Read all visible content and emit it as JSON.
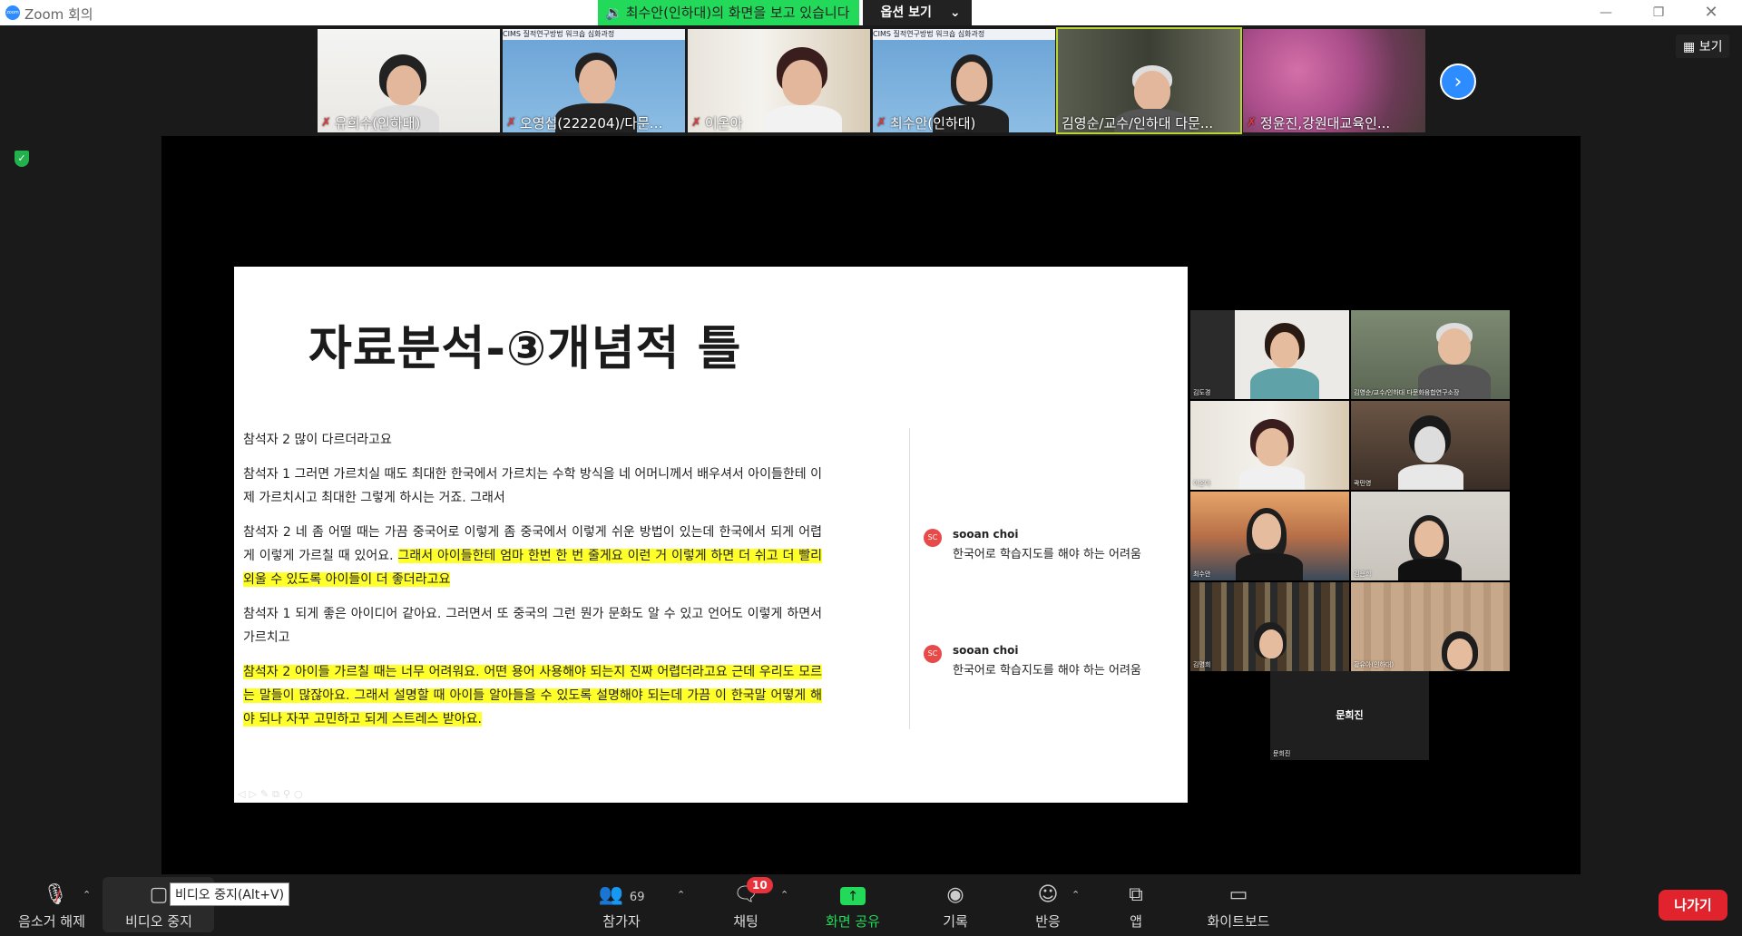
{
  "window": {
    "app_title": "Zoom 회의",
    "app_icon_text": "zoom"
  },
  "share_banner": {
    "message": "최수안(인하대)의 화면을 보고 있습니다",
    "options_label": "옵션 보기"
  },
  "view_button": {
    "label": "보기"
  },
  "participants_strip": [
    {
      "name": "유희수(인하대)",
      "muted": true
    },
    {
      "name": "오영섭(222204)/다문...",
      "muted": true,
      "banner": "CIMS 질적연구방법 워크숍 심화과정"
    },
    {
      "name": "이온아",
      "muted": true
    },
    {
      "name": "최수안(인하대)",
      "muted": true,
      "banner": "CIMS 질적연구방법 워크숍 심화과정"
    },
    {
      "name": "김영순/교수/인하대 다문...",
      "muted": false,
      "active": true
    },
    {
      "name": "정윤진,강원대교육인...",
      "muted": true
    }
  ],
  "slide": {
    "title": "자료분석-③개념적 틀",
    "paragraphs": [
      {
        "plain": "참석자 2 많이 다르더라고요",
        "highlight": "",
        "after": ""
      },
      {
        "plain": "참석자 1 그러면 가르치실 때도 최대한 한국에서 가르치는 수학 방식을 네 어머니께서 배우셔서 아이들한테 이제 가르치시고 최대한 그렇게 하시는 거죠. 그래서",
        "highlight": "",
        "after": ""
      },
      {
        "plain": "참석자 2 네 좀 어떨 때는 가끔 중국어로 이렇게 좀 중국에서 이렇게 쉬운 방법이 있는데 한국에서 되게 어렵게 이렇게 가르칠 때 있어요. ",
        "highlight": "그래서 아이들한테 엄마 한번 한 번 줄게요 이런 거 이렇게 하면 더 쉬고 더 빨리 외울 수 있도록 아이들이 더 좋더라고요",
        "after": ""
      },
      {
        "plain": "참석자 1 되게 좋은 아이디어 같아요. 그러면서 또 중국의 그런 뭔가 문화도 알 수 있고 언어도 이렇게 하면서 가르치고",
        "highlight": "",
        "after": ""
      },
      {
        "plain": "",
        "highlight": "참석자 2 아이들 가르칠 때는 너무 어려워요. 어떤 용어 사용해야 되는지 진짜 어렵더라고요 근데 우리도 모르는 말들이 많잖아요. 그래서 설명할 때 아이들 알아들을 수 있도록 설명해야 되는데 가끔 이 한국말 어떻게 해야 되나 자꾸 고민하고 되게 스트레스 받아요.",
        "after": ""
      }
    ],
    "comments": [
      {
        "avatar": "SC",
        "author": "sooan choi",
        "text": "한국어로 학습지도를 해야 하는 어려움"
      },
      {
        "avatar": "SC",
        "author": "sooan choi",
        "text": "한국어로 학습지도를 해야 하는 어려움"
      }
    ]
  },
  "gallery": [
    {
      "name": "김도경"
    },
    {
      "name": "김영순/교수/인하대 다문화융합연구소장"
    },
    {
      "name": "이온아"
    },
    {
      "name": "곽민영"
    },
    {
      "name": "최수안"
    },
    {
      "name": "김은희"
    },
    {
      "name": "김명희"
    },
    {
      "name": "황유아(인하대)"
    },
    {
      "name": "문희진",
      "video_off": true
    }
  ],
  "toolbar": {
    "mute": "음소거 해제",
    "video": "비디오 중지",
    "video_tooltip": "비디오 중지(Alt+V)",
    "participants": "참가자",
    "participants_count": "69",
    "chat": "채팅",
    "chat_badge": "10",
    "share": "화면 공유",
    "record": "기록",
    "reactions": "반응",
    "apps": "앱",
    "whiteboard": "화이트보드",
    "leave": "나가기"
  },
  "colors": {
    "share_green": "#23d959",
    "zoom_blue": "#2d8cff",
    "leave_red": "#e0232c",
    "highlight_yellow": "#ffff2a"
  }
}
